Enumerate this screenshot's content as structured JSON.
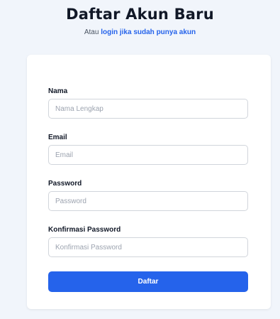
{
  "header": {
    "title": "Daftar Akun Baru",
    "subtitle_prefix": "Atau ",
    "login_link": "login jika sudah punya akun"
  },
  "form": {
    "name": {
      "label": "Nama",
      "placeholder": "Nama Lengkap",
      "value": ""
    },
    "email": {
      "label": "Email",
      "placeholder": "Email",
      "value": ""
    },
    "password": {
      "label": "Password",
      "placeholder": "Password",
      "value": ""
    },
    "confirm_password": {
      "label": "Konfirmasi Password",
      "placeholder": "Konfirmasi Password",
      "value": ""
    },
    "submit_label": "Daftar"
  },
  "colors": {
    "background": "#f1f5fb",
    "card": "#ffffff",
    "accent": "#2563eb",
    "title_text": "#111827",
    "placeholder_text": "#9ca3af"
  }
}
